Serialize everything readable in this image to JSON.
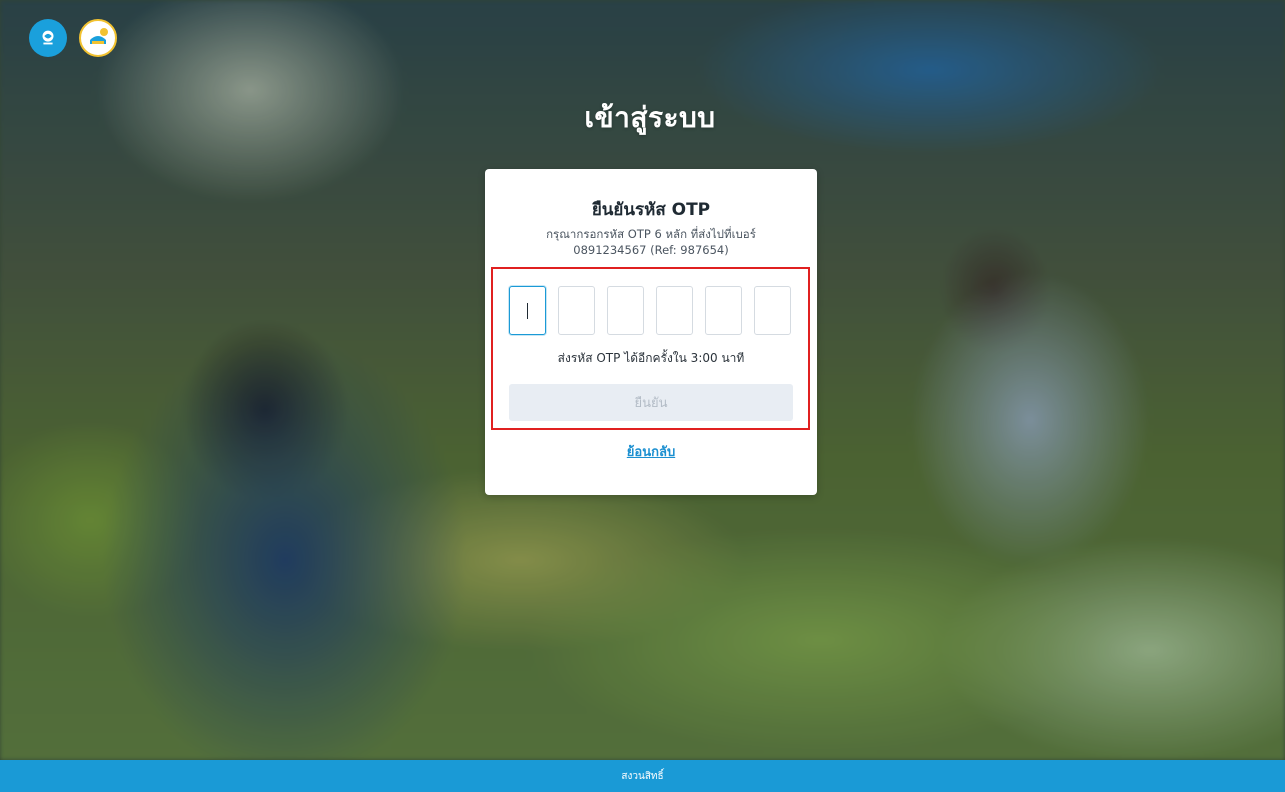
{
  "page": {
    "title": "เข้าสู่ระบบ"
  },
  "header": {
    "logos": [
      {
        "icon": "bank-logo-icon",
        "color": "#1aa0dc"
      },
      {
        "icon": "app-logo-icon",
        "color": "#f2c230"
      }
    ]
  },
  "otp_card": {
    "title": "ยืนยันรหัส OTP",
    "description_line1": "กรุณากรอกรหัส OTP 6 หลัก ที่ส่งไปที่เบอร์",
    "description_line2": "0891234567 (Ref: 987654)",
    "digits": [
      "",
      "",
      "",
      "",
      "",
      ""
    ],
    "active_digit_index": 0,
    "resend_text": "ส่งรหัส OTP ได้อีกครั้งใน 3:00 นาที",
    "confirm_label": "ยืนยัน",
    "confirm_enabled": false,
    "back_label": "ย้อนกลับ"
  },
  "footer": {
    "text": "สงวนสิทธิ์"
  },
  "colors": {
    "accent": "#1a9ad6",
    "highlight": "#e02020",
    "button_disabled_bg": "#e8edf3"
  }
}
